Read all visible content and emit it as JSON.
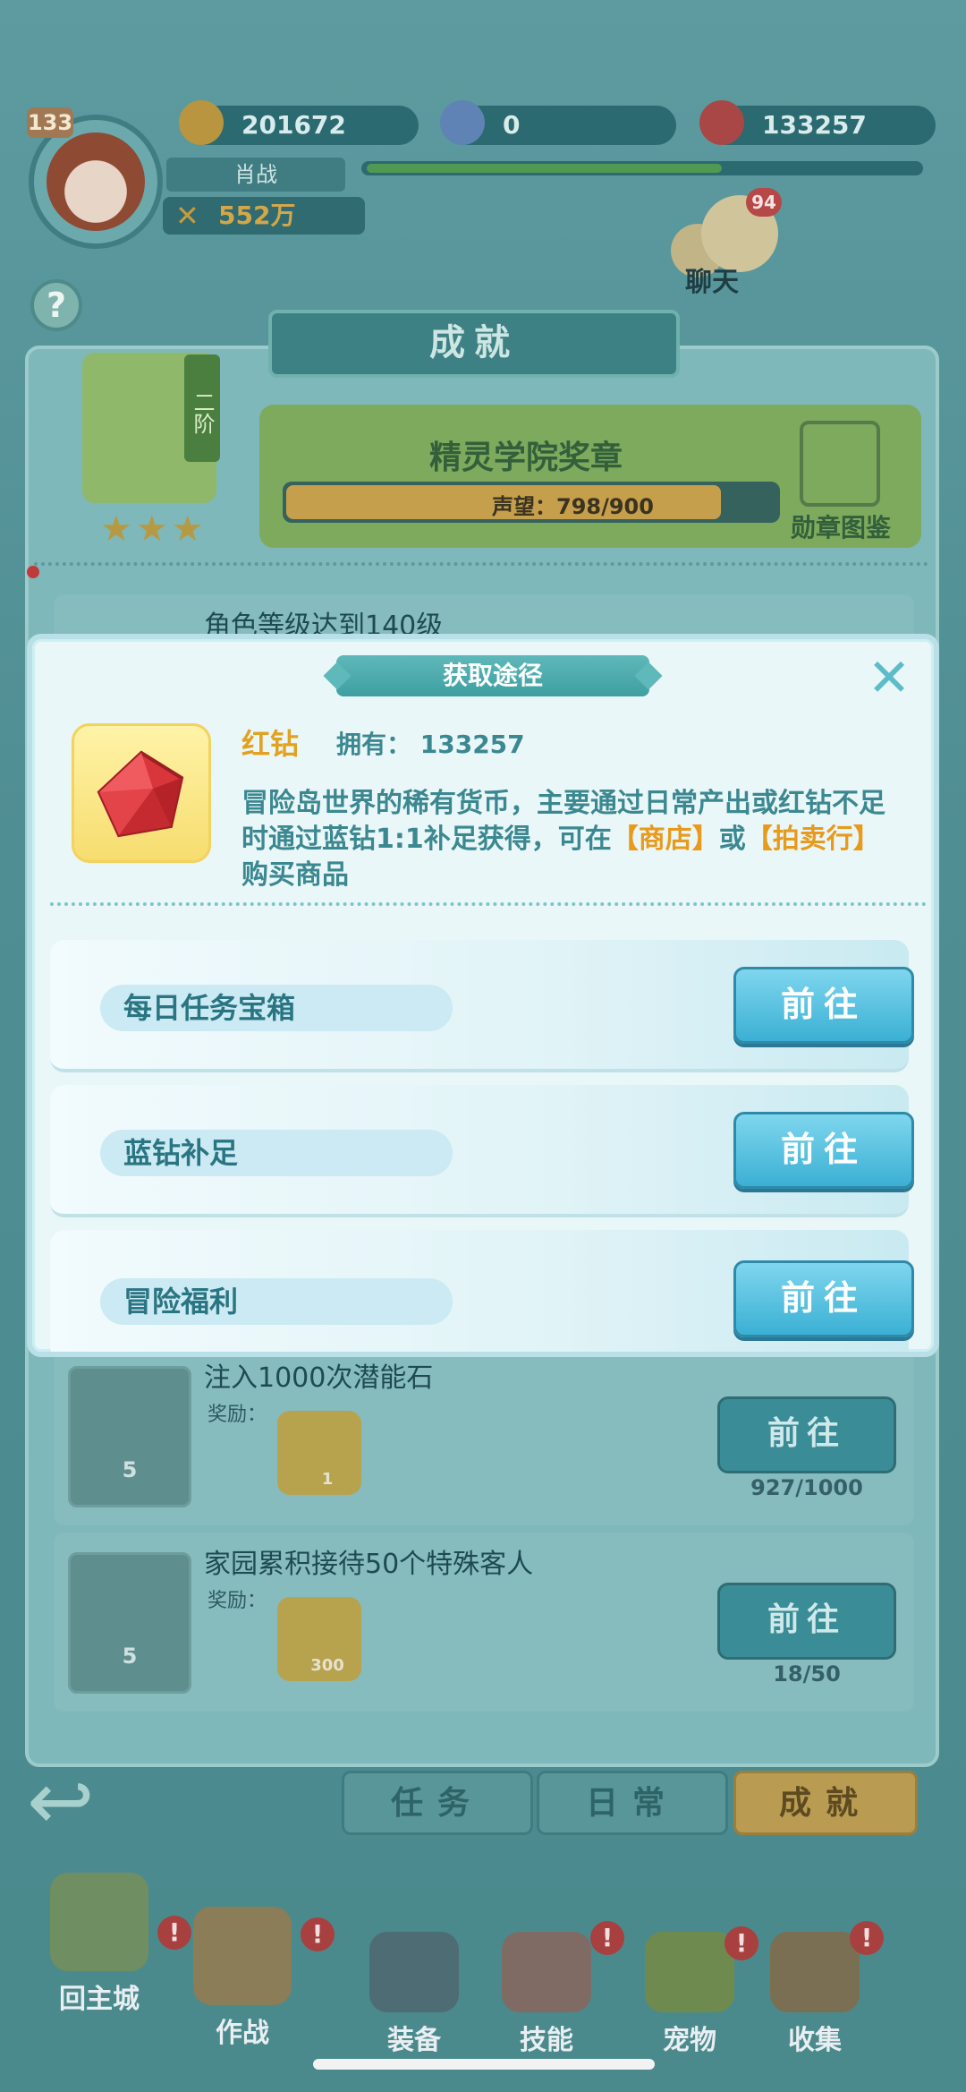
{
  "header": {
    "level": "133",
    "player_name": "肖战",
    "power": "552万",
    "gold": "201672",
    "blue_diamond": "0",
    "red_diamond": "133257",
    "exp_fraction": 0.64
  },
  "chat": {
    "label": "聊天",
    "unread": "94"
  },
  "help": "?",
  "panel": {
    "title": "成就",
    "medal": {
      "rank": "二阶",
      "stars": "★★★",
      "name": "精灵学院奖章",
      "reputation": "声望：798/900",
      "reputation_fraction": 0.887,
      "book_label": "勋章图鉴"
    }
  },
  "tasks": [
    {
      "title": "角色等级达到140级"
    },
    {
      "title": "注入1000次潜能石",
      "reward_label": "奖励：",
      "trophy_num": "5",
      "gem_num": "1",
      "go": "前往",
      "progress": "927/1000"
    },
    {
      "title": "家园累积接待50个特殊客人",
      "reward_label": "奖励：",
      "trophy_num": "5",
      "gem_num": "300",
      "go": "前往",
      "progress": "18/50"
    }
  ],
  "tabs": [
    "任务",
    "日常",
    "成就"
  ],
  "bottom_nav": [
    {
      "label": "回主城",
      "alert": "!"
    },
    {
      "label": "作战",
      "alert": "!"
    },
    {
      "label": "装备",
      "alert": ""
    },
    {
      "label": "技能",
      "alert": "!"
    },
    {
      "label": "宠物",
      "alert": "!"
    },
    {
      "label": "收集",
      "alert": "!"
    }
  ],
  "dialog": {
    "title": "获取途径",
    "close_icon": "close-icon",
    "item_name": "红钻",
    "owned": "拥有：  133257",
    "desc_1": "冒险岛世界的稀有货币，主要通过日常产出或红钻不足时通过蓝钻1:1补足获得，可在",
    "desc_shop": "【商店】",
    "desc_or": "或",
    "desc_auction": "【拍卖行】",
    "desc_2": "购买商品",
    "routes": [
      {
        "label": "每日任务宝箱",
        "go": "前往"
      },
      {
        "label": "蓝钻补足",
        "go": "前往"
      },
      {
        "label": "冒险福利",
        "go": "前往"
      }
    ]
  },
  "colors": {
    "accent_gold": "#e2a21f",
    "accent_teal": "#3c8891",
    "highlight_orange": "#e89a1c"
  }
}
